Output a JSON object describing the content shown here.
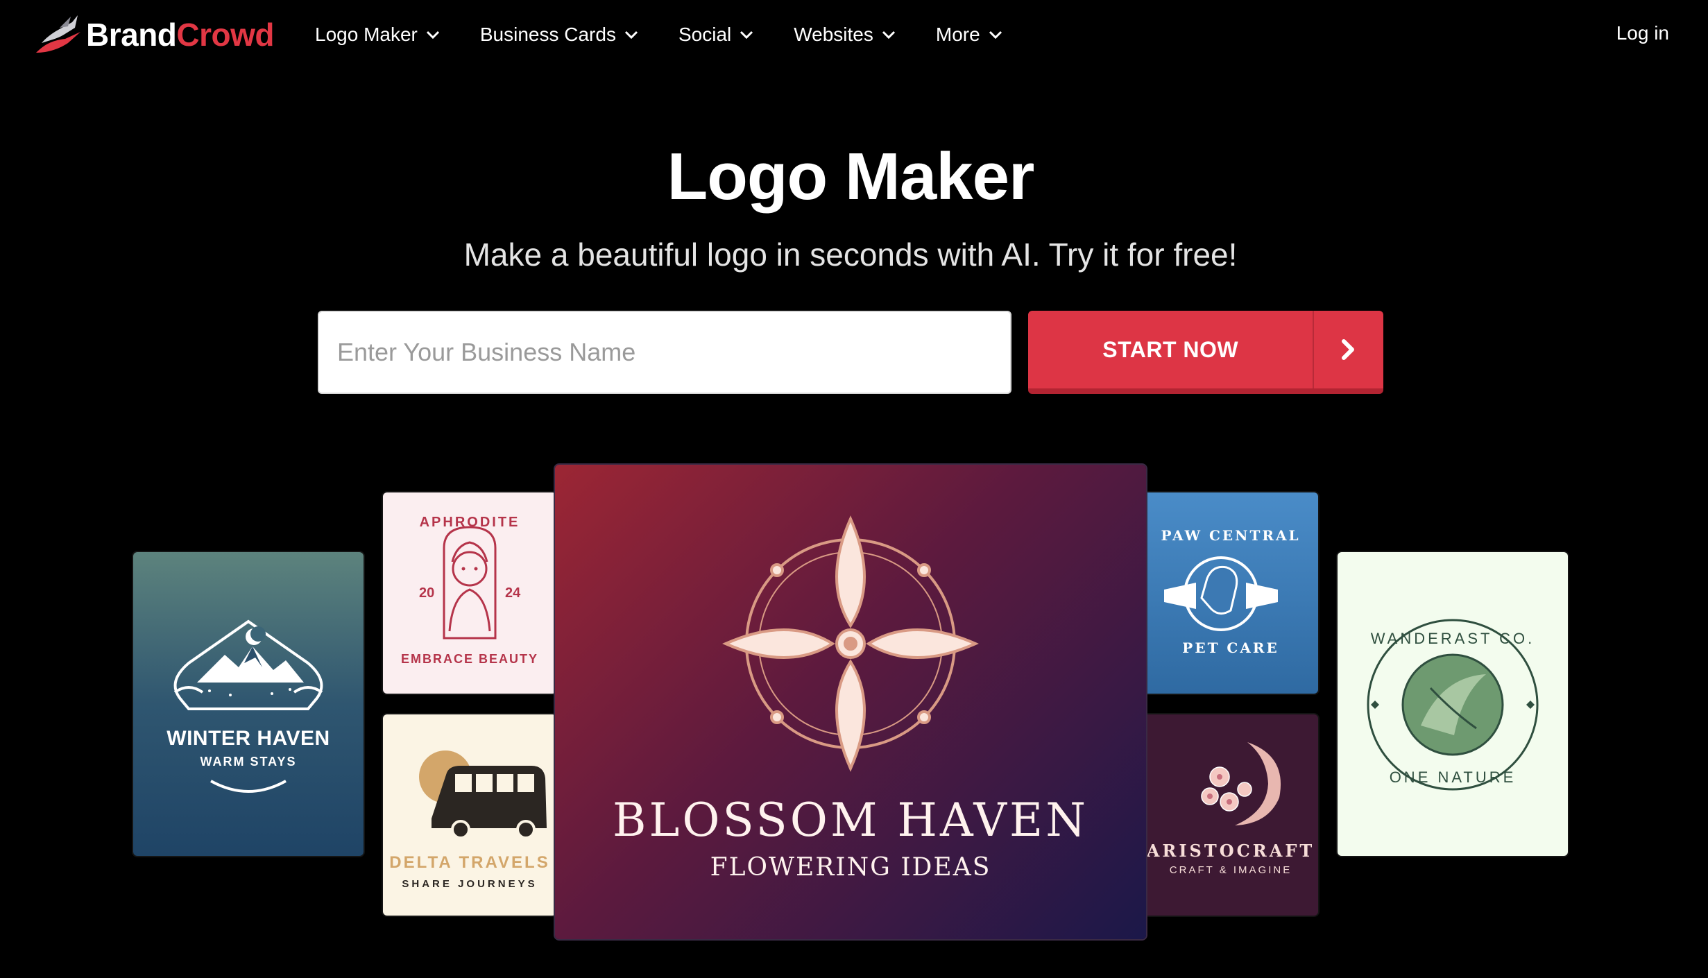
{
  "nav": {
    "brand": {
      "part1": "Brand",
      "part2": "Crowd",
      "icon": "brandcrowd-bird-logo"
    },
    "items": [
      {
        "label": "Logo Maker",
        "icon": "chevron-down-icon"
      },
      {
        "label": "Business Cards",
        "icon": "chevron-down-icon"
      },
      {
        "label": "Social",
        "icon": "chevron-down-icon"
      },
      {
        "label": "Websites",
        "icon": "chevron-down-icon"
      },
      {
        "label": "More",
        "icon": "chevron-down-icon"
      }
    ],
    "login": "Log in"
  },
  "hero": {
    "title": "Logo Maker",
    "subtitle": "Make a beautiful logo in seconds with AI. Try it for free!",
    "input_placeholder": "Enter Your Business Name",
    "input_value": "",
    "button_label": "START NOW",
    "button_icon": "chevron-right-icon"
  },
  "cards": {
    "winter": {
      "title": "WINTER HAVEN",
      "tagline": "WARM STAYS"
    },
    "aphrodite": {
      "top": "APHRODITE",
      "bottom": "EMBRACE BEAUTY",
      "year_left": "20",
      "year_right": "24"
    },
    "delta": {
      "title": "DELTA TRAVELS",
      "tagline": "SHARE JOURNEYS"
    },
    "blossom": {
      "title": "BLOSSOM HAVEN",
      "tagline": "FLOWERING IDEAS"
    },
    "paw": {
      "top": "PAW CENTRAL",
      "bottom": "PET CARE"
    },
    "aristo": {
      "title": "ARISTOCRAFT",
      "tagline": "CRAFT & IMAGINE"
    },
    "wander": {
      "top": "WANDERAST CO.",
      "bottom": "ONE NATURE"
    }
  },
  "colors": {
    "accent": "#dd3545",
    "background": "#000000",
    "brand_red": "#e23744"
  }
}
